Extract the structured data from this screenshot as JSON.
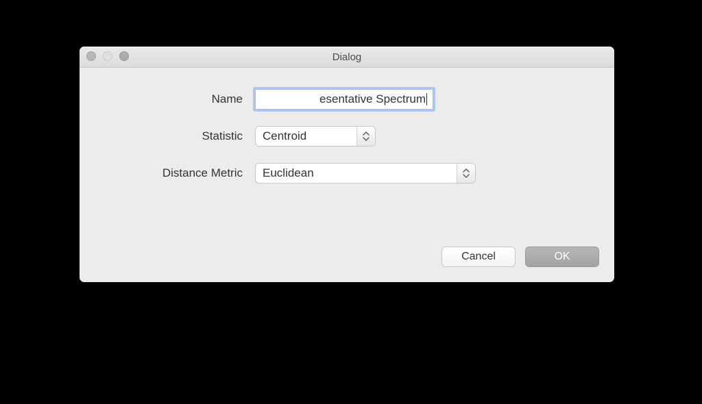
{
  "window": {
    "title": "Dialog"
  },
  "form": {
    "rows": [
      {
        "label": "Name",
        "value": "esentative Spectrum"
      },
      {
        "label": "Statistic",
        "value": "Centroid"
      },
      {
        "label": "Distance Metric",
        "value": "Euclidean"
      }
    ]
  },
  "buttons": {
    "cancel": "Cancel",
    "ok": "OK"
  }
}
